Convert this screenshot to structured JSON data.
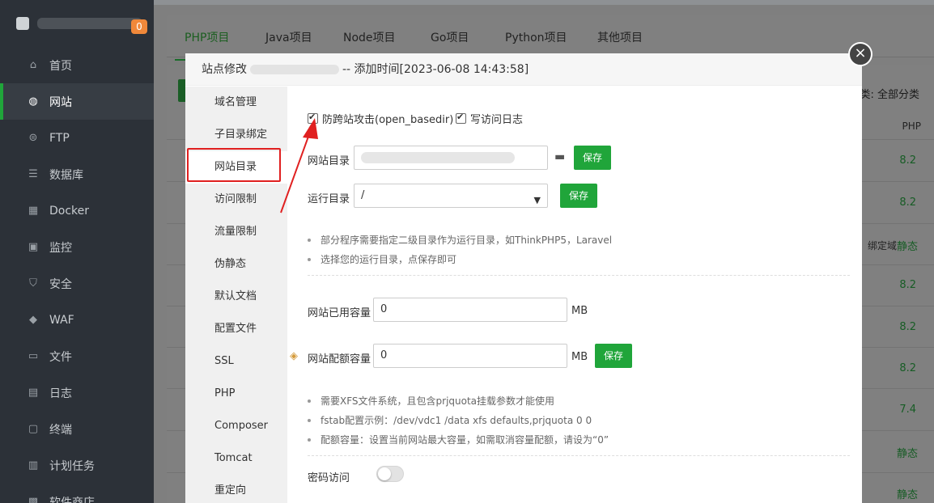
{
  "sidebar": {
    "badge": "0",
    "items": [
      {
        "label": "首页",
        "icon": "home-icon"
      },
      {
        "label": "网站",
        "icon": "globe-icon"
      },
      {
        "label": "FTP",
        "icon": "ftp-icon"
      },
      {
        "label": "数据库",
        "icon": "database-icon"
      },
      {
        "label": "Docker",
        "icon": "docker-icon"
      },
      {
        "label": "监控",
        "icon": "monitor-icon"
      },
      {
        "label": "安全",
        "icon": "shield-icon"
      },
      {
        "label": "WAF",
        "icon": "waf-icon"
      },
      {
        "label": "文件",
        "icon": "folder-icon"
      },
      {
        "label": "日志",
        "icon": "log-icon"
      },
      {
        "label": "终端",
        "icon": "terminal-icon"
      },
      {
        "label": "计划任务",
        "icon": "calendar-icon"
      },
      {
        "label": "软件商店",
        "icon": "store-icon"
      }
    ]
  },
  "project_tabs": [
    "PHP项目",
    "Java项目",
    "Node项目",
    "Go项目",
    "Python项目",
    "其他项目"
  ],
  "list": {
    "filter": "分类: 全部分类",
    "php_header": "PHP",
    "php_values": [
      "8.2",
      "8.2",
      "静态",
      "8.2",
      "8.2",
      "8.2",
      "7.4",
      "静态",
      "静态"
    ],
    "bind_text": "绑定域"
  },
  "modal": {
    "title_prefix": "站点修改",
    "title_suffix": "-- 添加时间[2023-06-08 14:43:58]",
    "close": "×",
    "menu": [
      "域名管理",
      "子目录绑定",
      "网站目录",
      "访问限制",
      "流量限制",
      "伪静态",
      "默认文档",
      "配置文件",
      "SSL",
      "PHP",
      "Composer",
      "Tomcat",
      "重定向"
    ],
    "checkbox_basedir": "防跨站攻击(open_basedir)",
    "checkbox_log": "写访问日志",
    "site_dir_label": "网站目录",
    "run_dir_label": "运行目录",
    "run_dir_value": "/",
    "save": "保存",
    "tips1": [
      "部分程序需要指定二级目录作为运行目录，如ThinkPHP5，Laravel",
      "选择您的运行目录，点保存即可"
    ],
    "used_label": "网站已用容量",
    "used_value": "0",
    "quota_label": "网站配额容量",
    "quota_value": "0",
    "unit": "MB",
    "tips2": [
      "需要XFS文件系统，且包含prjquota挂载参数才能使用",
      "fstab配置示例：/dev/vdc1 /data xfs defaults,prjquota 0 0",
      "配额容量：设置当前网站最大容量，如需取消容量配额，请设为“0”"
    ],
    "password_label": "密码访问"
  }
}
